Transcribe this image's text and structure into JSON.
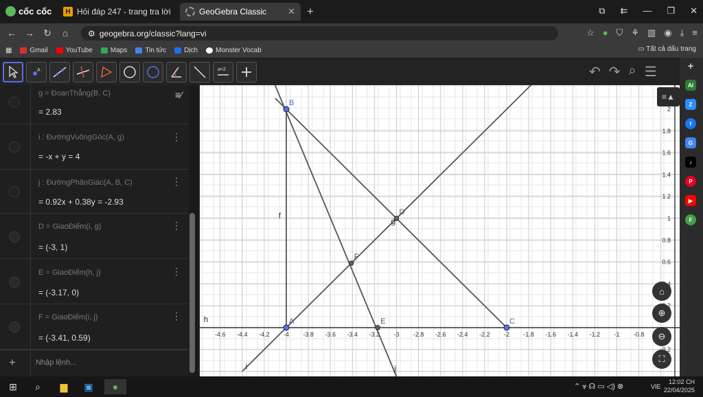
{
  "browser": {
    "logo": "cốc cốc",
    "tabs": [
      {
        "title": "Hỏi đáp 247 - trang tra lời",
        "active": false
      },
      {
        "title": "GeoGebra Classic",
        "active": true
      }
    ],
    "url": "geogebra.org/classic?lang=vi",
    "bookmarks": [
      "Gmail",
      "YouTube",
      "Maps",
      "Tin tức",
      "Dịch",
      "Monster Vocab"
    ],
    "all_bookmarks": "Tất cả dấu trang"
  },
  "algebra": {
    "rows": [
      {
        "def": "g = ĐoạnThẳng(B, C)",
        "val": "= 2.83"
      },
      {
        "def": "i : ĐườngVuôngGóc(A, g)",
        "val": "= -x + y = 4"
      },
      {
        "def": "j : ĐườngPhânGiác(A, B, C)",
        "val": "= 0.92x + 0.38y = -2.93"
      },
      {
        "def": "D = GiaoĐiểm(i, g)",
        "val": "= (-3, 1)"
      },
      {
        "def": "E = GiaoĐiểm(h, j)",
        "val": "= (-3.17, 0)"
      },
      {
        "def": "F = GiaoĐiểm(i, j)",
        "val": "= (-3.41, 0.59)"
      }
    ],
    "input_placeholder": "Nhập lệnh..."
  },
  "graph": {
    "x_ticks": [
      "-4.6",
      "-4.4",
      "-4.2",
      "-4",
      "-3.8",
      "-3.6",
      "-3.4",
      "-3.2",
      "-3",
      "-2.8",
      "-2.6",
      "-2.4",
      "-2.2",
      "-2",
      "-1.8",
      "-1.6",
      "-1.4",
      "-1.2",
      "-1",
      "-0.8"
    ],
    "y_ticks": [
      "2",
      "1.8",
      "1.6",
      "1.4",
      "1.2",
      "1",
      "0.8",
      "0.6",
      "0.4",
      "0.2",
      "0.2"
    ],
    "points": [
      {
        "name": "A",
        "x": -4,
        "y": 0
      },
      {
        "name": "B",
        "x": -4,
        "y": 2
      },
      {
        "name": "C",
        "x": -2,
        "y": 0
      },
      {
        "name": "D",
        "x": -3,
        "y": 1
      },
      {
        "name": "E",
        "x": -3.17,
        "y": 0
      },
      {
        "name": "F",
        "x": -3.41,
        "y": 0.59
      }
    ],
    "labels": [
      "h",
      "f",
      "g",
      "i",
      "j"
    ]
  },
  "taskbar": {
    "lang": "VIE",
    "time": "12:02 CH",
    "date": "22/04/2025"
  }
}
